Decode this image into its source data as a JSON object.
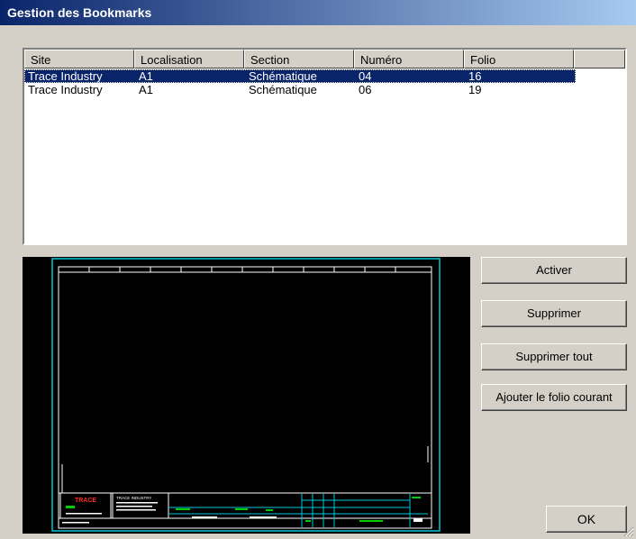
{
  "window": {
    "title": "Gestion des Bookmarks"
  },
  "list": {
    "columns": [
      "Site",
      "Localisation",
      "Section",
      "Numéro",
      "Folio"
    ],
    "rows": [
      {
        "site": "Trace Industry",
        "localisation": "A1",
        "section": "Schématique",
        "numero": "04",
        "folio": "16",
        "selected": true
      },
      {
        "site": "Trace Industry",
        "localisation": "A1",
        "section": "Schématique",
        "numero": "06",
        "folio": "19",
        "selected": false
      }
    ]
  },
  "preview": {
    "frame_color": "#00c8d8",
    "title_block": {
      "logo": "TRACE",
      "company": "TRACE INDUSTRY"
    }
  },
  "buttons": {
    "activate": "Activer",
    "delete": "Supprimer",
    "delete_all": "Supprimer tout",
    "add_current": "Ajouter le folio courant",
    "ok": "OK"
  },
  "colors": {
    "selection": "#0a246a",
    "face": "#d4d0c8"
  }
}
